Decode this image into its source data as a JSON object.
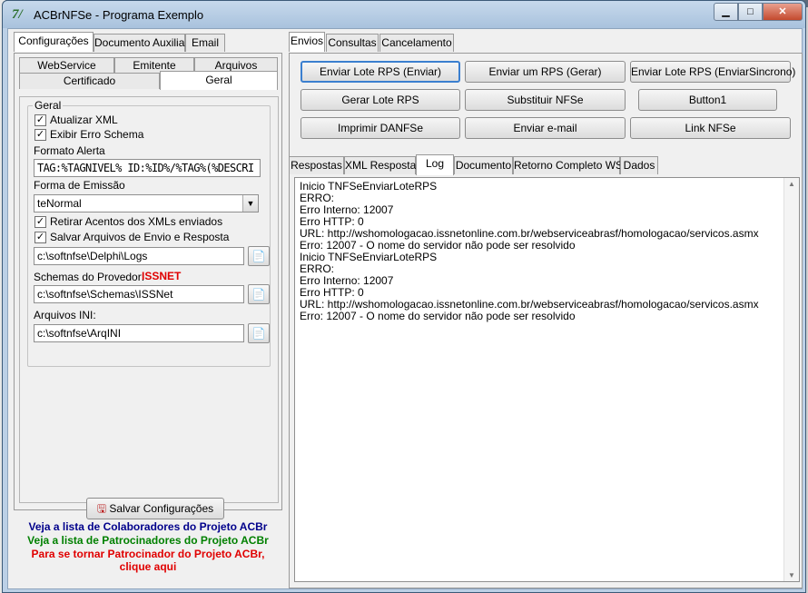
{
  "window": {
    "title": "ACBrNFSe - Programa Exemplo",
    "icon": "app-logo-icon"
  },
  "caption_buttons": {
    "minimize": "▁",
    "maximize": "□",
    "close": "✕"
  },
  "left_tabs": [
    "Configurações",
    "Documento Auxiliar",
    "Email"
  ],
  "config_subtabs_row1": [
    "WebService",
    "Emitente",
    "Arquivos"
  ],
  "config_subtabs_row2": [
    "Certificado",
    "Geral"
  ],
  "geral": {
    "group_title": "Geral",
    "atualizar_xml": {
      "label": "Atualizar XML",
      "checked": true
    },
    "exibir_erro_schema": {
      "label": "Exibir Erro Schema",
      "checked": true
    },
    "formato_alerta_label": "Formato Alerta",
    "formato_alerta_value": "TAG:%TAGNIVEL% ID:%ID%/%TAG%(%DESCRI",
    "forma_emissao_label": "Forma de Emissão",
    "forma_emissao_value": "teNormal",
    "retirar_acentos": {
      "label": "Retirar Acentos dos XMLs enviados",
      "checked": true
    },
    "salvar_arquivos": {
      "label": "Salvar Arquivos de Envio e Resposta",
      "checked": true
    },
    "logs_path": "c:\\softnfse\\Delphi\\Logs",
    "schemas_label": "Schemas do Provedor:",
    "schemas_provider": "ISSNET",
    "schemas_path": "c:\\softnfse\\Schemas\\ISSNet",
    "arquivos_ini_label": "Arquivos INI:",
    "arquivos_ini_path": "c:\\softnfse\\ArqINI"
  },
  "salvar_config_label": "Salvar Configurações",
  "links": {
    "colaboradores": "Veja a lista de Colaboradores do Projeto ACBr",
    "patrocinadores": "Veja a lista de Patrocinadores do Projeto ACBr",
    "patrocinador_line1": "Para se tornar Patrocinador do Projeto ACBr,",
    "patrocinador_line2": "clique aqui"
  },
  "right_tabs": [
    "Envios",
    "Consultas",
    "Cancelamento"
  ],
  "actions": {
    "row1": [
      "Enviar Lote RPS (Enviar)",
      "Enviar um RPS (Gerar)",
      "Enviar Lote RPS (EnviarSincrono)"
    ],
    "row2": [
      "Gerar Lote RPS",
      "Substituir NFSe",
      "Button1"
    ],
    "row3": [
      "Imprimir DANFSe",
      "Enviar e-mail",
      "Link NFSe"
    ]
  },
  "log_tabs": [
    "Respostas",
    "XML Resposta",
    "Log",
    "Documento",
    "Retorno Completo WS",
    "Dados"
  ],
  "log_lines": [
    "Inicio TNFSeEnviarLoteRPS",
    "ERRO:",
    "Erro Interno: 12007",
    "Erro HTTP: 0",
    "URL: http://wshomologacao.issnetonline.com.br/webserviceabrasf/homologacao/servicos.asmx",
    "Erro: 12007 - O nome do servidor não pode ser resolvido",
    "Inicio TNFSeEnviarLoteRPS",
    "ERRO:",
    "Erro Interno: 12007",
    "Erro HTTP: 0",
    "URL: http://wshomologacao.issnetonline.com.br/webserviceabrasf/homologacao/servicos.asmx",
    "Erro: 12007 - O nome do servidor não pode ser resolvido"
  ],
  "colors": {
    "link_blue": "#00008b",
    "link_green": "#008000",
    "link_red": "#e00000",
    "provider_red": "#e00000"
  }
}
